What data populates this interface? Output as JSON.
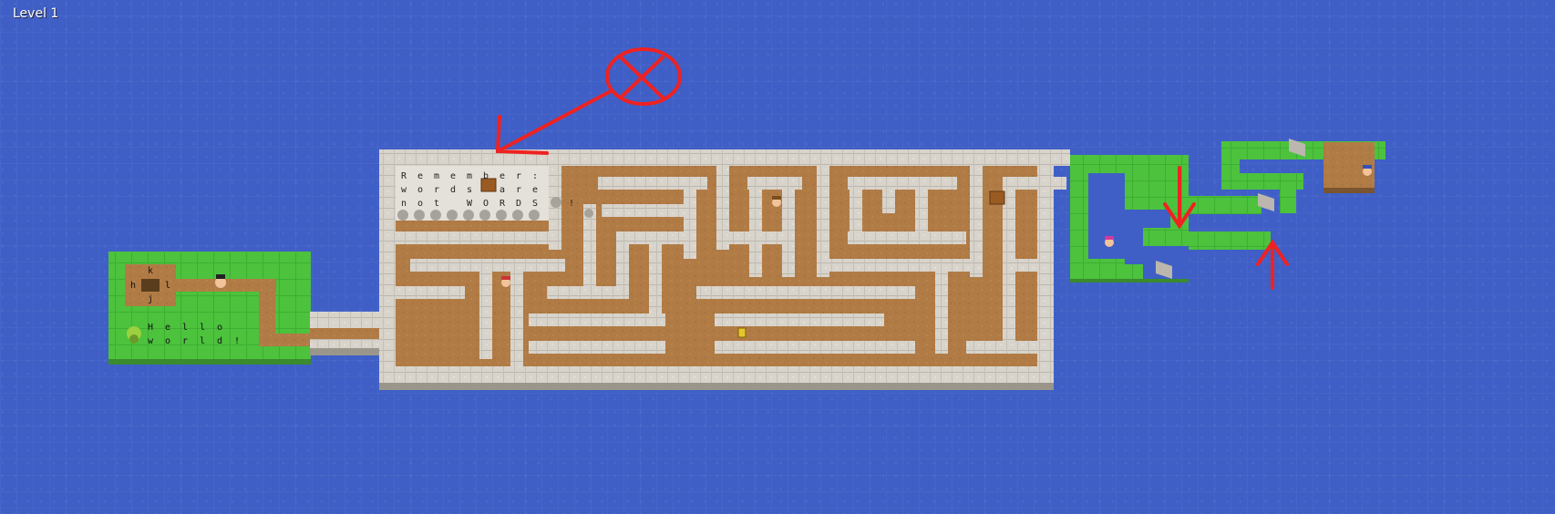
{
  "hud": {
    "level_label": "Level 1"
  },
  "colors": {
    "water": "#3f5fc6",
    "grass": "#4cc23d",
    "dirt": "#b17b45",
    "stone": "#d8d4cc",
    "annotation": "#ee2222"
  },
  "start_island": {
    "keys": [
      "k",
      "h",
      "l",
      "j"
    ],
    "greeting_row1": [
      "H",
      "e",
      "l",
      "l",
      "o"
    ],
    "greeting_row2": [
      "w",
      "o",
      "r",
      "l",
      "d",
      "!"
    ]
  },
  "maze_sign": {
    "row1": [
      "R",
      "e",
      "m",
      "e",
      "m",
      "b",
      "e",
      "r",
      ":"
    ],
    "row2": [
      "w",
      "o",
      "r",
      "d",
      "s",
      "",
      "a",
      "r",
      "e"
    ],
    "row3": [
      "n",
      "o",
      "t",
      "",
      "W",
      "O",
      "R",
      "D",
      "S",
      "",
      "!"
    ]
  },
  "icons": [
    "player-character-icon",
    "npc-character-icon",
    "treasure-chest-icon",
    "boulder-icon",
    "yellow-key-icon",
    "crossed-circle-annotation-icon",
    "red-arrow-annotation-icon"
  ]
}
